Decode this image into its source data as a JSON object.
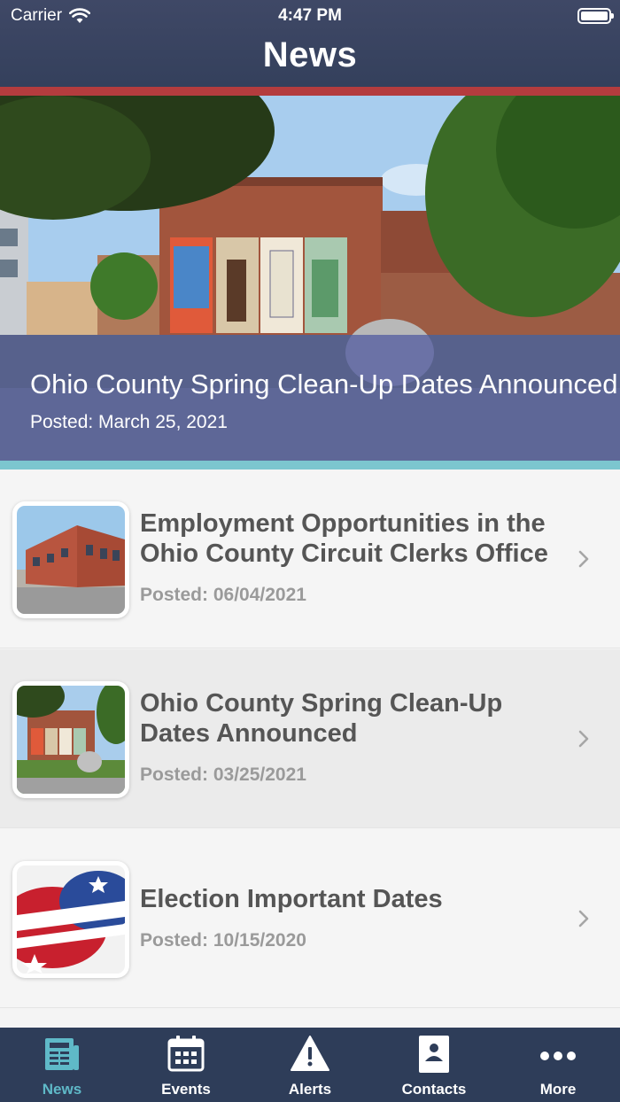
{
  "status_bar": {
    "carrier": "Carrier",
    "time": "4:47 PM"
  },
  "nav": {
    "title": "News"
  },
  "hero": {
    "title": "Ohio County Spring Clean-Up Dates Announced",
    "posted": "Posted: March 25, 2021"
  },
  "news": [
    {
      "title": "Employment Opportunities in the Ohio County Circuit Clerks Office",
      "posted": "Posted: 06/04/2021",
      "icon": "building-photo"
    },
    {
      "title": "Ohio County Spring Clean-Up Dates Announced",
      "posted": "Posted: 03/25/2021",
      "icon": "mural-photo"
    },
    {
      "title": "Election Important Dates",
      "posted": "Posted: 10/15/2020",
      "icon": "vote-buttons-photo"
    }
  ],
  "tabs": [
    {
      "label": "News",
      "icon": "newspaper-icon",
      "active": true
    },
    {
      "label": "Events",
      "icon": "calendar-icon",
      "active": false
    },
    {
      "label": "Alerts",
      "icon": "warning-icon",
      "active": false
    },
    {
      "label": "Contacts",
      "icon": "contact-card-icon",
      "active": false
    },
    {
      "label": "More",
      "icon": "more-dots-icon",
      "active": false
    }
  ],
  "colors": {
    "header": "#3b4563",
    "header_accent": "#b43c3e",
    "hero_accent": "#7cc6cf",
    "tabbar": "#2e3d59",
    "tab_active": "#5fb9c8"
  }
}
